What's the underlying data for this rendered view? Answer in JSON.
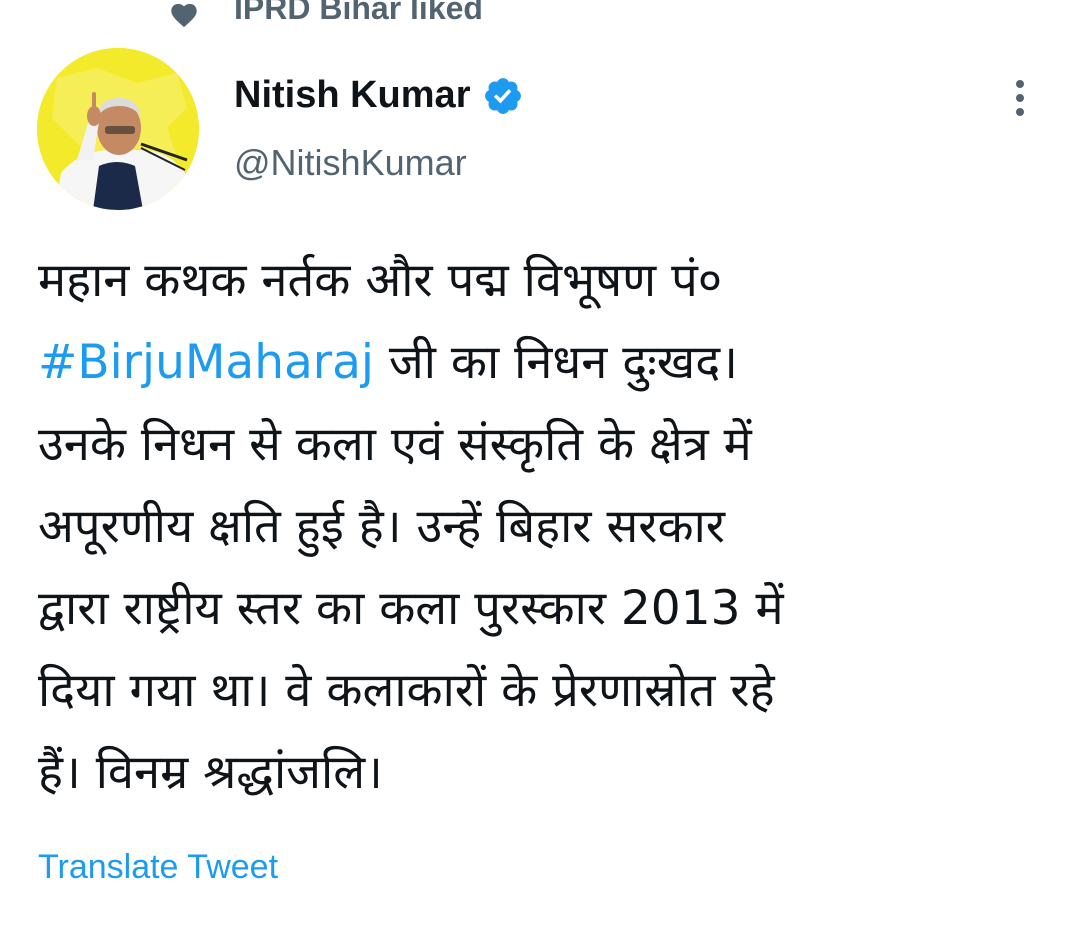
{
  "social_context": {
    "text": "IPRD Bihar liked",
    "icon": "heart-icon"
  },
  "author": {
    "display_name": "Nitish Kumar",
    "handle": "@NitishKumar",
    "verified": true,
    "verified_icon": "verified-badge-icon",
    "avatar_bg_color": "#f3e92a"
  },
  "tweet": {
    "lines": [
      {
        "segments": [
          {
            "text": "महान कथक नर्तक और पद्म विभूषण पं०",
            "link": false
          }
        ]
      },
      {
        "segments": [
          {
            "text": "#BirjuMaharaj",
            "link": true
          },
          {
            "text": " जी का निधन दुःखद।",
            "link": false
          }
        ]
      },
      {
        "segments": [
          {
            "text": "उनके निधन से कला एवं संस्कृति के क्षेत्र में",
            "link": false
          }
        ]
      },
      {
        "segments": [
          {
            "text": "अपूरणीय क्षति हुई है। उन्हें बिहार सरकार",
            "link": false
          }
        ]
      },
      {
        "segments": [
          {
            "text": "द्वारा राष्ट्रीय स्तर का कला पुरस्कार 2013 में",
            "link": false
          }
        ]
      },
      {
        "segments": [
          {
            "text": "दिया गया था। वे कलाकारों के प्रेरणास्रोत रहे",
            "link": false
          }
        ]
      },
      {
        "segments": [
          {
            "text": "हैं। विनम्र श्रद्धांजलि।",
            "link": false
          }
        ]
      }
    ],
    "translate_label": "Translate Tweet"
  },
  "colors": {
    "link": "#1d9bf0",
    "secondary_text": "#536471",
    "primary_text": "#0f1419"
  },
  "icons": {
    "more": "more-vertical-icon"
  }
}
